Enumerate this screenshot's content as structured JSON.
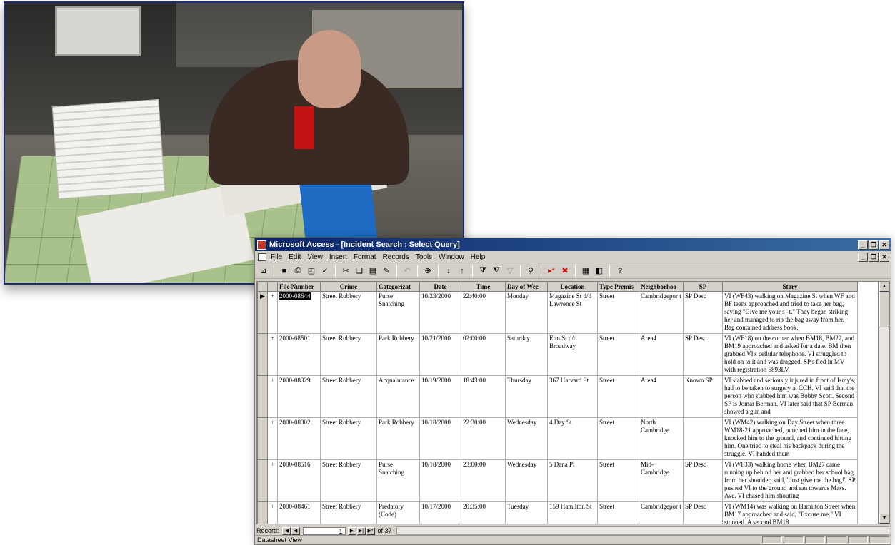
{
  "window": {
    "title": "Microsoft Access - [Incident Search : Select Query]"
  },
  "menu": [
    "File",
    "Edit",
    "View",
    "Insert",
    "Format",
    "Records",
    "Tools",
    "Window",
    "Help"
  ],
  "grid": {
    "headers": [
      "File Number",
      "Crime",
      "Categorizat",
      "Date",
      "Time",
      "Day of Wee",
      "Location",
      "Type Premis",
      "Neighborhoo",
      "SP",
      "Story"
    ],
    "rows": [
      {
        "file": "2000-08644",
        "crime": "Street Robbery",
        "cat": "Purse Snatching",
        "date": "10/23/2000",
        "time": "22:40:00",
        "day": "Monday",
        "loc": "Magazine St d/d Lawrence St",
        "prem": "Street",
        "nbhd": "Cambridgepor t",
        "sp": "SP Desc",
        "story": "VI (WF43) walking on Magazine St when WF and BF teens approached and tried to take her bag, saying \"Give me your s--t.\" They began striking her and managed to rip the bag away from her. Bag contained address book,"
      },
      {
        "file": "2000-08501",
        "crime": "Street Robbery",
        "cat": "Park Robbery",
        "date": "10/21/2000",
        "time": "02:00:00",
        "day": "Saturday",
        "loc": "Elm St d/d Broadway",
        "prem": "Street",
        "nbhd": "Area4",
        "sp": "SP Desc",
        "story": "VI (WF18) on the corner when BM18, BM22, and BM19 approached and asked for a date. BM then grabbed VI's cellular telephone. VI struggled to hold on to it and was dragged. SP's fled in MV with registration 5893LV,"
      },
      {
        "file": "2000-08329",
        "crime": "Street Robbery",
        "cat": "Acquaintance",
        "date": "10/19/2000",
        "time": "18:43:00",
        "day": "Thursday",
        "loc": "367 Harvard St",
        "prem": "Street",
        "nbhd": "Area4",
        "sp": "Known SP",
        "story": "VI stabbed and seriously injured in front of Ismy's, had to be taken to surgery at CCH. VI said that the person who stabbed him was Bobby Scott. Second SP is Jomar Berman. VI later said that SP Berman showed a gun and"
      },
      {
        "file": "2000-08302",
        "crime": "Street Robbery",
        "cat": "Park Robbery",
        "date": "10/18/2000",
        "time": "22:30:00",
        "day": "Wednesday",
        "loc": "4 Day St",
        "prem": "Street",
        "nbhd": "North Cambridge",
        "sp": "",
        "story": "VI (WM42) walking on Day Street when three WM18-21 approached, punched him in the face, knocked him to the ground, and continued hitting him. One tried to steal his backpack during the struggle. VI handed them"
      },
      {
        "file": "2000-08516",
        "crime": "Street Robbery",
        "cat": "Purse Snatching",
        "date": "10/18/2000",
        "time": "23:00:00",
        "day": "Wednesday",
        "loc": "5 Dana Pl",
        "prem": "Street",
        "nbhd": "Mid-Cambridge",
        "sp": "SP Desc",
        "story": "VI (WF33) walking home when BM27 came running up behind her and grabbed her school bag from her shoulder, said, \"Just give me the bag!\" SP pushed VI to the ground and ran towards Mass. Ave. VI chased him shouting"
      },
      {
        "file": "2000-08461",
        "crime": "Street Robbery",
        "cat": "Predatory (Code)",
        "date": "10/17/2000",
        "time": "20:35:00",
        "day": "Tuesday",
        "loc": "159 Hamilton St",
        "prem": "Street",
        "nbhd": "Cambridgepor t",
        "sp": "SP Desc",
        "story": "VI (WM14) was walking on Hamilton Street when BM17 approached and said, \"Excuse me.\" VI stopped. A second BM18"
      }
    ]
  },
  "nav": {
    "record_label": "Record:",
    "current": "1",
    "of_text": "of 37"
  },
  "status": {
    "view": "Datasheet View"
  }
}
